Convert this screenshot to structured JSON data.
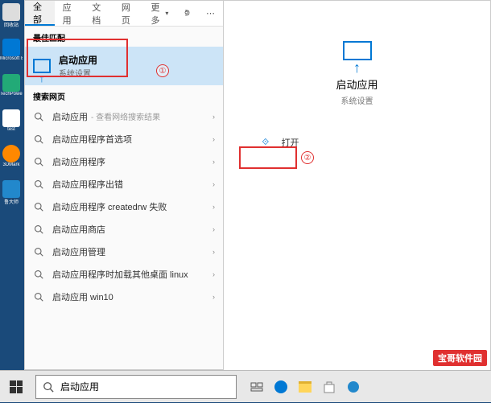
{
  "desktop": {
    "icons": [
      {
        "label": "回收站"
      },
      {
        "label": "Microsoft Edge"
      },
      {
        "label": "TechPower GPU-..."
      },
      {
        "label": "test"
      },
      {
        "label": "3DMark"
      },
      {
        "label": "鲁大师"
      }
    ]
  },
  "tabs": {
    "all": "全部",
    "apps": "应用",
    "docs": "文档",
    "web": "网页",
    "more": "更多"
  },
  "sections": {
    "best_match": "最佳匹配",
    "search_web": "搜索网页"
  },
  "best_match": {
    "title": "启动应用",
    "subtitle": "系统设置"
  },
  "web_results": [
    {
      "text": "启动应用",
      "hint": "- 查看网络搜索结果",
      "chevron": true
    },
    {
      "text": "启动应用程序首选项",
      "chevron": true
    },
    {
      "text": "启动应用程序",
      "chevron": true
    },
    {
      "text": "启动应用程序出错",
      "chevron": true
    },
    {
      "text": "启动应用程序 createdrw 失败",
      "chevron": true
    },
    {
      "text": "启动应用商店",
      "chevron": true
    },
    {
      "text": "启动应用管理",
      "chevron": true
    },
    {
      "text": "启动应用程序时加载其他桌面 linux",
      "chevron": true
    },
    {
      "text": "启动应用 win10",
      "chevron": true
    }
  ],
  "preview": {
    "title": "启动应用",
    "subtitle": "系统设置",
    "action_open": "打开"
  },
  "search": {
    "value": "启动应用"
  },
  "annotations": {
    "num1": "①",
    "num2": "②"
  },
  "watermark": "宝哥软件园"
}
